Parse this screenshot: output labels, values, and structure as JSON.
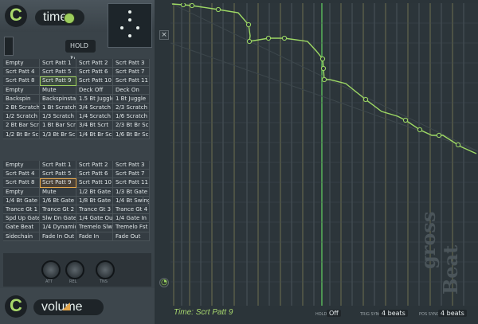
{
  "header": {
    "logo_letter": "C",
    "title": "time"
  },
  "hold": {
    "label": "HOLD ↻"
  },
  "pattern_groups": [
    {
      "rows": [
        [
          "Empty",
          "Scrt Patt 1",
          "Scrt Patt 2",
          "Scrt Patt 3"
        ],
        [
          "Scrt Patt 4",
          "Scrt Patt 5",
          "Scrt Patt 6",
          "Scrt Patt 7"
        ],
        [
          "Scrt Patt 8",
          "Scrt Patt 9",
          "Scrt Patt 10",
          "Scrt Patt 11"
        ],
        [
          "Empty",
          "Mute",
          "Deck Off",
          "Deck On"
        ],
        [
          "Backspin",
          "Backspinstart",
          "1.5 Bt Juggle",
          "1 Bt Juggle"
        ],
        [
          "2 Bt Scratch",
          "1 Bt Scratch",
          "3/4 Scratch",
          "2/3 Scratch"
        ],
        [
          "1/2 Scratch",
          "1/3 Scratch",
          "1/4 Scratch",
          "1/6 Scratch"
        ],
        [
          "2 Bt Bar Scrt",
          "1 Bt Bar Scrt",
          "3/4 Bt Scrt",
          "2/3 Bt Br Scrt"
        ],
        [
          "1/2 Bt Br Scrt",
          "1/3 Bt Br Scrt",
          "1/4 Bt Br Scrt",
          "1/6 Bt Br Scrt"
        ]
      ]
    },
    {
      "rows": [
        [
          "Empty",
          "Scrt Patt 1",
          "Scrt Patt 2",
          "Scrt Patt 3"
        ],
        [
          "Scrt Patt 4",
          "Scrt Patt 5",
          "Scrt Patt 6",
          "Scrt Patt 7"
        ],
        [
          "Scrt Patt 8",
          "Scrt Patt 9",
          "Scrt Patt 10",
          "Scrt Patt 11"
        ],
        [
          "Empty",
          "Mute",
          "1/2 Bt Gate",
          "1/3 Bt Gate"
        ],
        [
          "1/4 Bt Gate",
          "1/6 Bt Gate",
          "1/8 Bt Gate",
          "1/4 Bt Swing"
        ],
        [
          "Trance Gt 1",
          "Trance Gt 2",
          "Trance Gt 3",
          "Trance Gt 4"
        ],
        [
          "Spd Up Gate",
          "Slw Dn Gate",
          "1/4 Gate Out",
          "1/4 Gate In"
        ],
        [
          "Gate Beat",
          "1/4 Dynamic",
          "Tremelo Slw",
          "Tremelo Fst"
        ],
        [
          "Sidechain",
          "Fade In Out",
          "Fade In",
          "Fade Out"
        ]
      ]
    }
  ],
  "knobs": [
    {
      "label": "ATT"
    },
    {
      "label": "REL"
    },
    {
      "label": "TNS"
    }
  ],
  "volume": {
    "logo_letter": "C",
    "title": "volume"
  },
  "status": {
    "title": "Time: Scrt Patt 9",
    "hold_label": "HOLD",
    "hold_value": "Off",
    "trig_label": "TRIG SYNC",
    "trig_value": "4 beats",
    "pos_label": "POS SYNC",
    "pos_value": "4 beats"
  },
  "watermark": {
    "line1": "gross",
    "line2": "Beat"
  }
}
